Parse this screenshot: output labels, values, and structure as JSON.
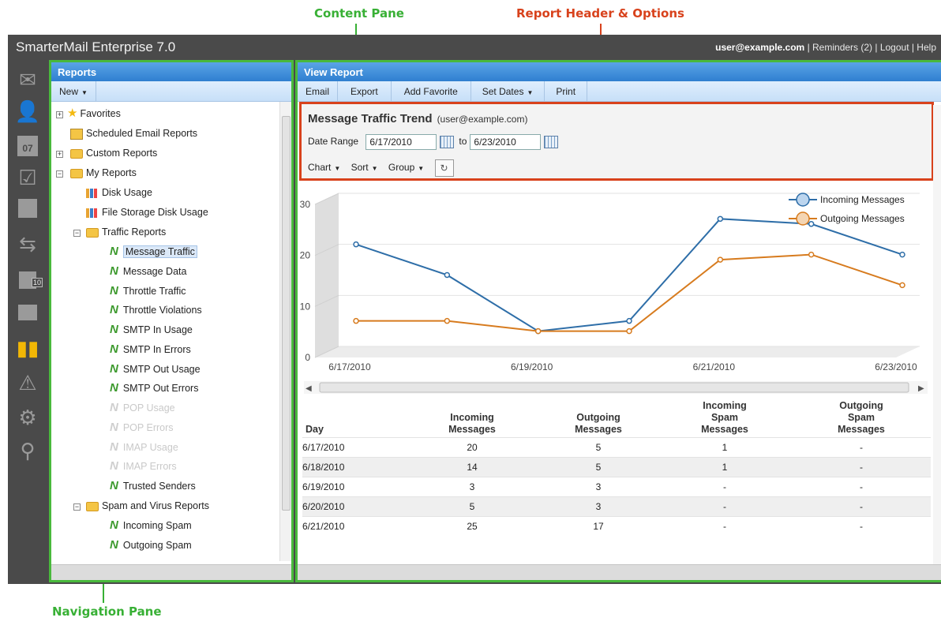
{
  "annotations": {
    "content_pane": "Content Pane",
    "report_header": "Report Header & Options",
    "navigation_pane": "Navigation Pane"
  },
  "app": {
    "title": "SmarterMail Enterprise 7.0",
    "user": "user@example.com",
    "links": "| Reminders (2) | Logout | Help"
  },
  "iconbar": {
    "items": [
      "mail-icon",
      "contacts-icon",
      "calendar-icon",
      "tasks-icon",
      "notes-icon",
      "sync-icon",
      "rss-icon",
      "files-icon",
      "reports-icon",
      "alerts-icon",
      "settings-icon",
      "search-icon"
    ],
    "calendar_day": "07",
    "rss_badge": "10"
  },
  "nav": {
    "header": "Reports",
    "new_label": "New",
    "tree": [
      {
        "label": "Favorites"
      },
      {
        "label": "Scheduled Email Reports"
      },
      {
        "label": "Custom Reports"
      },
      {
        "label": "My Reports"
      },
      {
        "label": "Disk Usage"
      },
      {
        "label": "File Storage Disk Usage"
      },
      {
        "label": "Traffic Reports"
      },
      {
        "label": "Message Traffic"
      },
      {
        "label": "Message Data"
      },
      {
        "label": "Throttle Traffic"
      },
      {
        "label": "Throttle Violations"
      },
      {
        "label": "SMTP In Usage"
      },
      {
        "label": "SMTP In Errors"
      },
      {
        "label": "SMTP Out Usage"
      },
      {
        "label": "SMTP Out Errors"
      },
      {
        "label": "POP Usage"
      },
      {
        "label": "POP Errors"
      },
      {
        "label": "IMAP Usage"
      },
      {
        "label": "IMAP Errors"
      },
      {
        "label": "Trusted Senders"
      },
      {
        "label": "Spam and Virus Reports"
      },
      {
        "label": "Incoming Spam"
      },
      {
        "label": "Outgoing Spam"
      }
    ]
  },
  "content": {
    "header": "View Report",
    "toolbar": {
      "email": "Email",
      "export": "Export",
      "add_favorite": "Add Favorite",
      "set_dates": "Set Dates",
      "print": "Print"
    },
    "report": {
      "title": "Message Traffic Trend",
      "subtitle": "(user@example.com)",
      "date_range_label": "Date Range",
      "from": "6/17/2010",
      "to_label": "to",
      "to": "6/23/2010",
      "options": {
        "chart": "Chart",
        "sort": "Sort",
        "group": "Group"
      }
    },
    "table": {
      "headers": [
        "Day",
        "Incoming Messages",
        "Outgoing Messages",
        "Incoming Spam Messages",
        "Outgoing Spam Messages"
      ],
      "rows": [
        [
          "6/17/2010",
          "20",
          "5",
          "1",
          "-"
        ],
        [
          "6/18/2010",
          "14",
          "5",
          "1",
          "-"
        ],
        [
          "6/19/2010",
          "3",
          "3",
          "-",
          "-"
        ],
        [
          "6/20/2010",
          "5",
          "3",
          "-",
          "-"
        ],
        [
          "6/21/2010",
          "25",
          "17",
          "-",
          "-"
        ]
      ]
    }
  },
  "colors": {
    "accent": "#2f7fd0",
    "pane_outline": "#49b93c",
    "header_outline": "#d8421c",
    "incoming": "#2e6ea8",
    "outgoing": "#d77b1e"
  },
  "chart_data": {
    "type": "line",
    "x": [
      "6/17/2010",
      "6/18/2010",
      "6/19/2010",
      "6/20/2010",
      "6/21/2010",
      "6/22/2010",
      "6/23/2010"
    ],
    "tick_labels": [
      "6/17/2010",
      "6/19/2010",
      "6/21/2010",
      "6/23/2010"
    ],
    "ylim": [
      0,
      30
    ],
    "yticks": [
      0,
      10,
      20,
      30
    ],
    "series": [
      {
        "name": "Incoming Messages",
        "values": [
          20,
          14,
          3,
          5,
          25,
          24,
          18
        ]
      },
      {
        "name": "Outgoing Messages",
        "values": [
          5,
          5,
          3,
          3,
          17,
          18,
          12
        ]
      }
    ],
    "legend": "top-right",
    "grid": true
  }
}
